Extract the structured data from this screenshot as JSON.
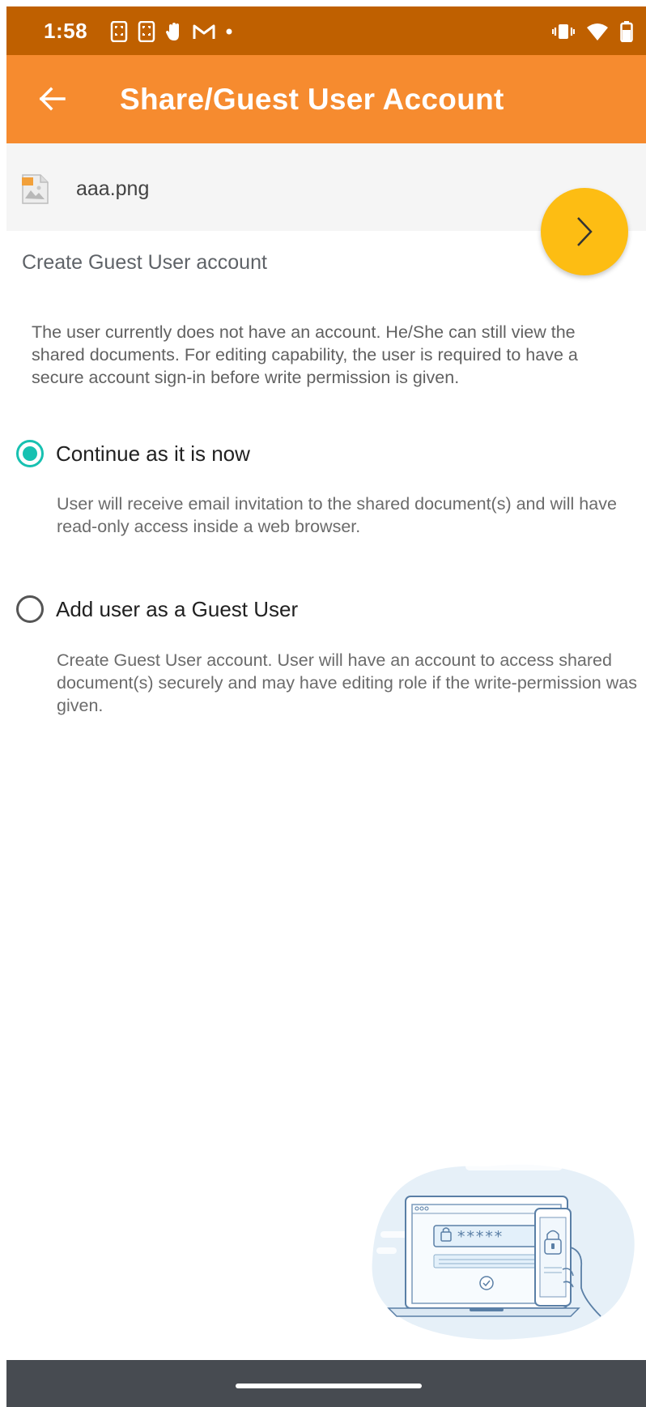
{
  "status_bar": {
    "time": "1:58",
    "left_icons": [
      "screenshot-icon",
      "screenshot-icon",
      "hand-icon",
      "gmail-icon",
      "dot-icon"
    ],
    "right_icons": [
      "vibrate-icon",
      "wifi-icon",
      "battery-icon"
    ],
    "background": "#bf6000"
  },
  "app_bar": {
    "title": "Share/Guest User Account",
    "back_icon": "arrow-back-icon",
    "background": "#f68b2f"
  },
  "file": {
    "name": "aaa.png",
    "icon": "image-file-icon"
  },
  "fab": {
    "icon": "chevron-right-icon",
    "color": "#fdbd13"
  },
  "section": {
    "title": "Create Guest User account",
    "info": "The user currently does not have an account. He/She can still view the shared documents. For editing capability, the user is required to have a secure account sign-in before write permission is given."
  },
  "options": [
    {
      "label": "Continue as it is now",
      "description": "User will receive email invitation to the shared document(s) and will have read-only access inside a web browser.",
      "selected": true
    },
    {
      "label": "Add user as a Guest User",
      "description": "Create Guest User account. User will have an account to access shared document(s) securely and may have editing role if the write-permission was given.",
      "selected": false
    }
  ],
  "illustration": {
    "password_mask": "*****",
    "accent": "#17c1b1"
  },
  "nav_bar": {
    "background": "#474b51"
  }
}
